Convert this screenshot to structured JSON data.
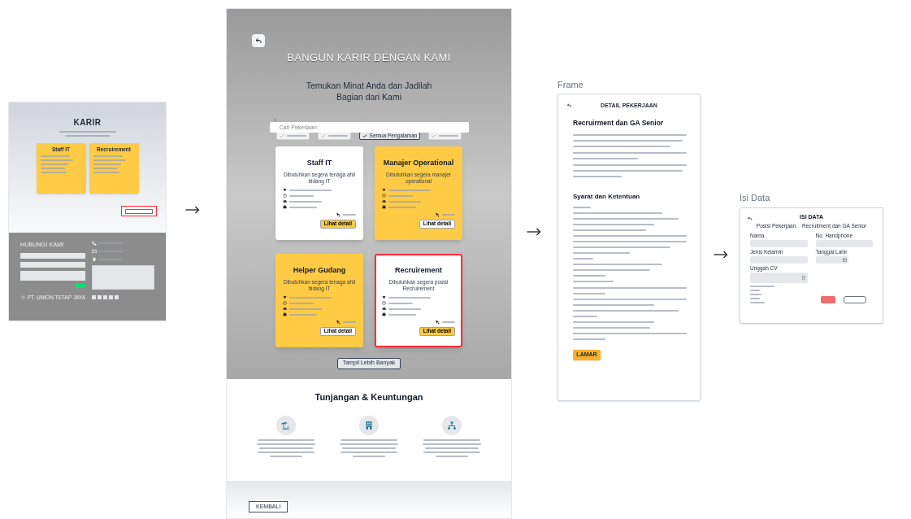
{
  "home_frame": {
    "title": "KARIR",
    "cards": [
      {
        "title": "Staff IT"
      },
      {
        "title": "Recruirement"
      }
    ],
    "more_button": {
      "highlighted": true
    },
    "contact_heading": "HUBUNGI KAMI",
    "company": "PT. UNION TETAP JAYA"
  },
  "career_frame": {
    "heading": "BANGUN KARIR DENGAN KAMI",
    "subtitle": "Temukan Minat Anda dan Jadilah Bagian dari Kami",
    "search": {
      "placeholder": "Cari Pekerjaan"
    },
    "filters": [
      {
        "selected": false
      },
      {
        "selected": false
      },
      {
        "label": "Semua Pengalaman",
        "selected": true
      },
      {
        "selected": false
      }
    ],
    "jobs": [
      {
        "title": "Staff IT",
        "description": "Dibutuhkan segera tenaga ahli bidang IT",
        "color": "#ffffff",
        "button": "Lihat detail",
        "highlighted": false
      },
      {
        "title": "Manajer Operational",
        "description": "Dibutuhkan segera manajer operational",
        "color": "#ffcb45",
        "button": "Lihat detail",
        "highlighted": false
      },
      {
        "title": "Helper Gudang",
        "description": "Dibutuhkan segera tenaga ahli bidang IT",
        "color": "#ffcb45",
        "button": "Lihat detail",
        "highlighted": false
      },
      {
        "title": "Recruirement",
        "description": "Dibutuhkan segera posisi Recruirement",
        "color": "#ffffff",
        "button": "Lihat detail",
        "highlighted": true
      }
    ],
    "more_button": "Tampil Lebih Banyak",
    "benefits_heading": "Tunjangan & Keuntungan",
    "benefits": [
      {
        "kind": "beach"
      },
      {
        "kind": "building"
      },
      {
        "kind": "network"
      }
    ],
    "back_button": "KEMBALI"
  },
  "detail_frame": {
    "label": "Frame",
    "header": "DETAIL PEKERJAAN",
    "title": "Recruirment dan GA Senior",
    "requirements_heading": "Syarat dan Ketentuan",
    "apply_button": "LAMAR"
  },
  "form_frame": {
    "label": "Isi Data",
    "header": "ISI DATA",
    "position_label": "Posisi Pekerjaan:",
    "position": "Recruitment dan GA Senior",
    "fields": [
      {
        "label": "Nama",
        "kind": "text"
      },
      {
        "label": "No. Handphone",
        "kind": "text"
      },
      {
        "label": "Jenis Kelamin",
        "kind": "select"
      },
      {
        "label": "Tanggal Lahir",
        "kind": "date"
      },
      {
        "label": "Unggah CV",
        "kind": "file"
      }
    ]
  }
}
